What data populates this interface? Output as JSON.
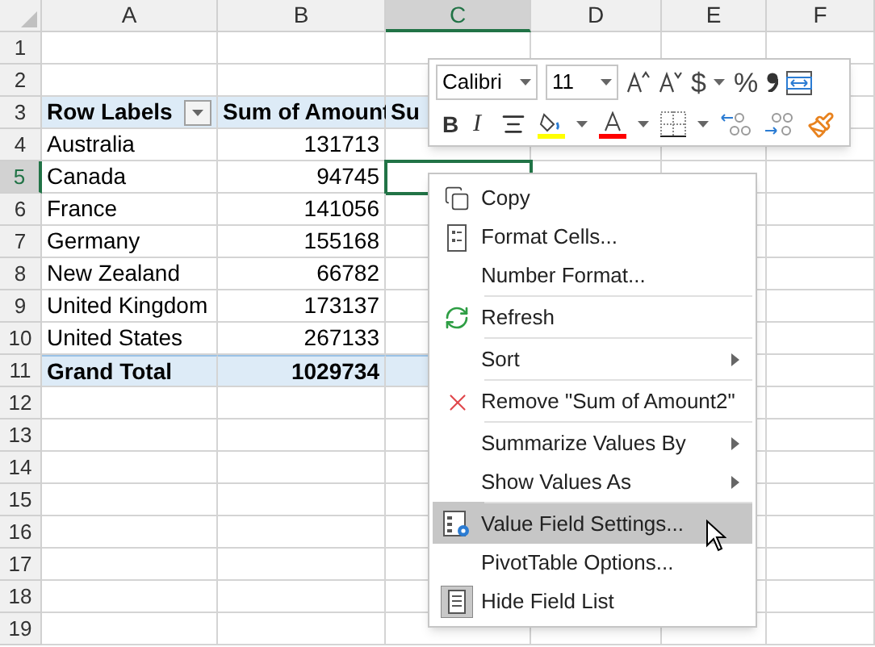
{
  "columns": [
    {
      "label": "A",
      "selected": false
    },
    {
      "label": "B",
      "selected": false
    },
    {
      "label": "C",
      "selected": true
    },
    {
      "label": "D",
      "selected": false
    },
    {
      "label": "E",
      "selected": false
    },
    {
      "label": "F",
      "selected": false
    }
  ],
  "rows": [
    {
      "number": "1",
      "selected": false,
      "kind": "empty",
      "cells": []
    },
    {
      "number": "2",
      "selected": false,
      "kind": "empty",
      "cells": []
    },
    {
      "number": "3",
      "selected": false,
      "kind": "header",
      "filter": true,
      "cells": [
        {
          "text": "Row Labels",
          "active": false
        },
        {
          "text": "Sum of Amount",
          "active": false
        },
        {
          "text": "Su",
          "active": false
        }
      ]
    },
    {
      "number": "4",
      "selected": false,
      "kind": "data",
      "cells": [
        {
          "text": "Australia",
          "active": false
        },
        {
          "text": "131713",
          "active": false
        }
      ]
    },
    {
      "number": "5",
      "selected": true,
      "kind": "data",
      "cells": [
        {
          "text": "Canada",
          "active": false
        },
        {
          "text": "94745",
          "active": false
        },
        {
          "active": true
        }
      ]
    },
    {
      "number": "6",
      "selected": false,
      "kind": "data",
      "cells": [
        {
          "text": "France",
          "active": false
        },
        {
          "text": "141056",
          "active": false
        }
      ]
    },
    {
      "number": "7",
      "selected": false,
      "kind": "data",
      "cells": [
        {
          "text": "Germany",
          "active": false
        },
        {
          "text": "155168",
          "active": false
        }
      ]
    },
    {
      "number": "8",
      "selected": false,
      "kind": "data",
      "cells": [
        {
          "text": "New Zealand",
          "active": false
        },
        {
          "text": "66782",
          "active": false
        }
      ]
    },
    {
      "number": "9",
      "selected": false,
      "kind": "data",
      "cells": [
        {
          "text": "United Kingdom",
          "active": false
        },
        {
          "text": "173137",
          "active": false
        }
      ]
    },
    {
      "number": "10",
      "selected": false,
      "kind": "data",
      "cells": [
        {
          "text": "United States",
          "active": false
        },
        {
          "text": "267133",
          "active": false
        }
      ]
    },
    {
      "number": "11",
      "selected": false,
      "kind": "total",
      "cells": [
        {
          "text": "Grand Total",
          "active": false
        },
        {
          "text": "1029734",
          "active": false
        }
      ]
    },
    {
      "number": "12",
      "selected": false,
      "kind": "empty",
      "cells": []
    },
    {
      "number": "13",
      "selected": false,
      "kind": "empty",
      "cells": []
    },
    {
      "number": "14",
      "selected": false,
      "kind": "empty",
      "cells": []
    },
    {
      "number": "15",
      "selected": false,
      "kind": "empty",
      "cells": []
    },
    {
      "number": "16",
      "selected": false,
      "kind": "empty",
      "cells": []
    },
    {
      "number": "17",
      "selected": false,
      "kind": "empty",
      "cells": []
    },
    {
      "number": "18",
      "selected": false,
      "kind": "empty",
      "cells": []
    },
    {
      "number": "19",
      "selected": false,
      "kind": "empty",
      "cells": []
    }
  ],
  "mini_toolbar": {
    "font": "Calibri",
    "size": "11",
    "currency": "$",
    "percent": "%",
    "bold": "B",
    "italic": "I"
  },
  "context_menu": [
    {
      "label": "Copy",
      "kind": "copy",
      "submenu": false,
      "separator_before": false,
      "selected": false
    },
    {
      "label": "Format Cells...",
      "kind": "format-cells",
      "submenu": false,
      "separator_before": false,
      "selected": false
    },
    {
      "label": "Number Format...",
      "kind": "plain",
      "submenu": false,
      "separator_before": false,
      "selected": false
    },
    {
      "label": "Refresh",
      "kind": "refresh",
      "submenu": false,
      "separator_before": true,
      "selected": false
    },
    {
      "label": "Sort",
      "kind": "plain",
      "submenu": true,
      "separator_before": true,
      "selected": false
    },
    {
      "label": "Remove \"Sum of Amount2\"",
      "kind": "remove",
      "submenu": false,
      "separator_before": true,
      "selected": false
    },
    {
      "label": "Summarize Values By",
      "kind": "plain",
      "submenu": true,
      "separator_before": true,
      "selected": false
    },
    {
      "label": "Show Values As",
      "kind": "plain",
      "submenu": true,
      "separator_before": false,
      "selected": false
    },
    {
      "label": "Value Field Settings...",
      "kind": "settings",
      "submenu": false,
      "separator_before": true,
      "selected": true
    },
    {
      "label": "PivotTable Options...",
      "kind": "plain",
      "submenu": false,
      "separator_before": false,
      "selected": false
    },
    {
      "label": "Hide Field List",
      "kind": "field-list",
      "submenu": false,
      "separator_before": false,
      "selected": false
    }
  ]
}
